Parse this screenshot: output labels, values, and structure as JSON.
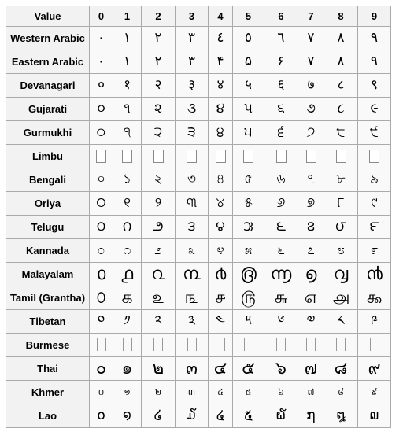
{
  "table": {
    "header": {
      "label": "Value",
      "digits": [
        "0",
        "1",
        "2",
        "3",
        "4",
        "5",
        "6",
        "7",
        "8",
        "9"
      ]
    },
    "rows": [
      {
        "script": "Western Arabic",
        "style": "normal",
        "glyphs": [
          "٠",
          "١",
          "٢",
          "٣",
          "٤",
          "٥",
          "٦",
          "٧",
          "٨",
          "٩"
        ]
      },
      {
        "script": "Eastern Arabic",
        "style": "normal",
        "glyphs": [
          "۰",
          "۱",
          "۲",
          "۳",
          "۴",
          "۵",
          "۶",
          "۷",
          "۸",
          "۹"
        ]
      },
      {
        "script": "Devanagari",
        "style": "normal",
        "glyphs": [
          "०",
          "१",
          "२",
          "३",
          "४",
          "५",
          "६",
          "७",
          "८",
          "९"
        ]
      },
      {
        "script": "Gujarati",
        "style": "normal",
        "glyphs": [
          "૦",
          "૧",
          "૨",
          "૩",
          "૪",
          "૫",
          "૬",
          "૭",
          "૮",
          "૯"
        ]
      },
      {
        "script": "Gurmukhi",
        "style": "normal",
        "glyphs": [
          "੦",
          "੧",
          "੨",
          "੩",
          "੪",
          "੫",
          "੬",
          "੭",
          "੮",
          "੯"
        ]
      },
      {
        "script": "Limbu",
        "style": "box",
        "glyphs": [
          "",
          "",
          "",
          "",
          "",
          "",
          "",
          "",
          "",
          ""
        ]
      },
      {
        "script": "Bengali",
        "style": "normal",
        "glyphs": [
          "০",
          "১",
          "২",
          "৩",
          "৪",
          "৫",
          "৬",
          "৭",
          "৮",
          "৯"
        ]
      },
      {
        "script": "Oriya",
        "style": "normal",
        "glyphs": [
          "୦",
          "୧",
          "୨",
          "୩",
          "୪",
          "୫",
          "୬",
          "୭",
          "୮",
          "୯"
        ]
      },
      {
        "script": "Telugu",
        "style": "normal",
        "glyphs": [
          "౦",
          "౧",
          "౨",
          "౩",
          "౪",
          "౫",
          "౬",
          "౭",
          "౮",
          "౯"
        ]
      },
      {
        "script": "Kannada",
        "style": "normal",
        "glyphs": [
          "೦",
          "೧",
          "೨",
          "೩",
          "೪",
          "೫",
          "೬",
          "೭",
          "೮",
          "೯"
        ]
      },
      {
        "script": "Malayalam",
        "style": "big",
        "glyphs": [
          "൦",
          "൧",
          "൨",
          "൩",
          "൪",
          "൫",
          "൬",
          "൭",
          "൮",
          "൯"
        ]
      },
      {
        "script": "Tamil (Grantha)",
        "style": "big",
        "glyphs": [
          "௦",
          "௧",
          "௨",
          "௩",
          "௪",
          "௫",
          "௬",
          "௭",
          "௮",
          "௯"
        ]
      },
      {
        "script": "Tibetan",
        "style": "normal",
        "glyphs": [
          "༠",
          "༡",
          "༢",
          "༣",
          "༤",
          "༥",
          "༦",
          "༧",
          "༨",
          "༩"
        ]
      },
      {
        "script": "Burmese",
        "style": "bars",
        "glyphs": [
          "",
          "",
          "",
          "",
          "",
          "",
          "",
          "",
          "",
          ""
        ]
      },
      {
        "script": "Thai",
        "style": "big",
        "glyphs": [
          "๐",
          "๑",
          "๒",
          "๓",
          "๔",
          "๕",
          "๖",
          "๗",
          "๘",
          "๙"
        ]
      },
      {
        "script": "Khmer",
        "style": "small",
        "glyphs": [
          "០",
          "១",
          "២",
          "៣",
          "៤",
          "៥",
          "៦",
          "៧",
          "៨",
          "៩"
        ]
      },
      {
        "script": "Lao",
        "style": "normal",
        "glyphs": [
          "໐",
          "໑",
          "໒",
          "໓",
          "໔",
          "໕",
          "໖",
          "໗",
          "໘",
          "໙"
        ]
      }
    ]
  }
}
